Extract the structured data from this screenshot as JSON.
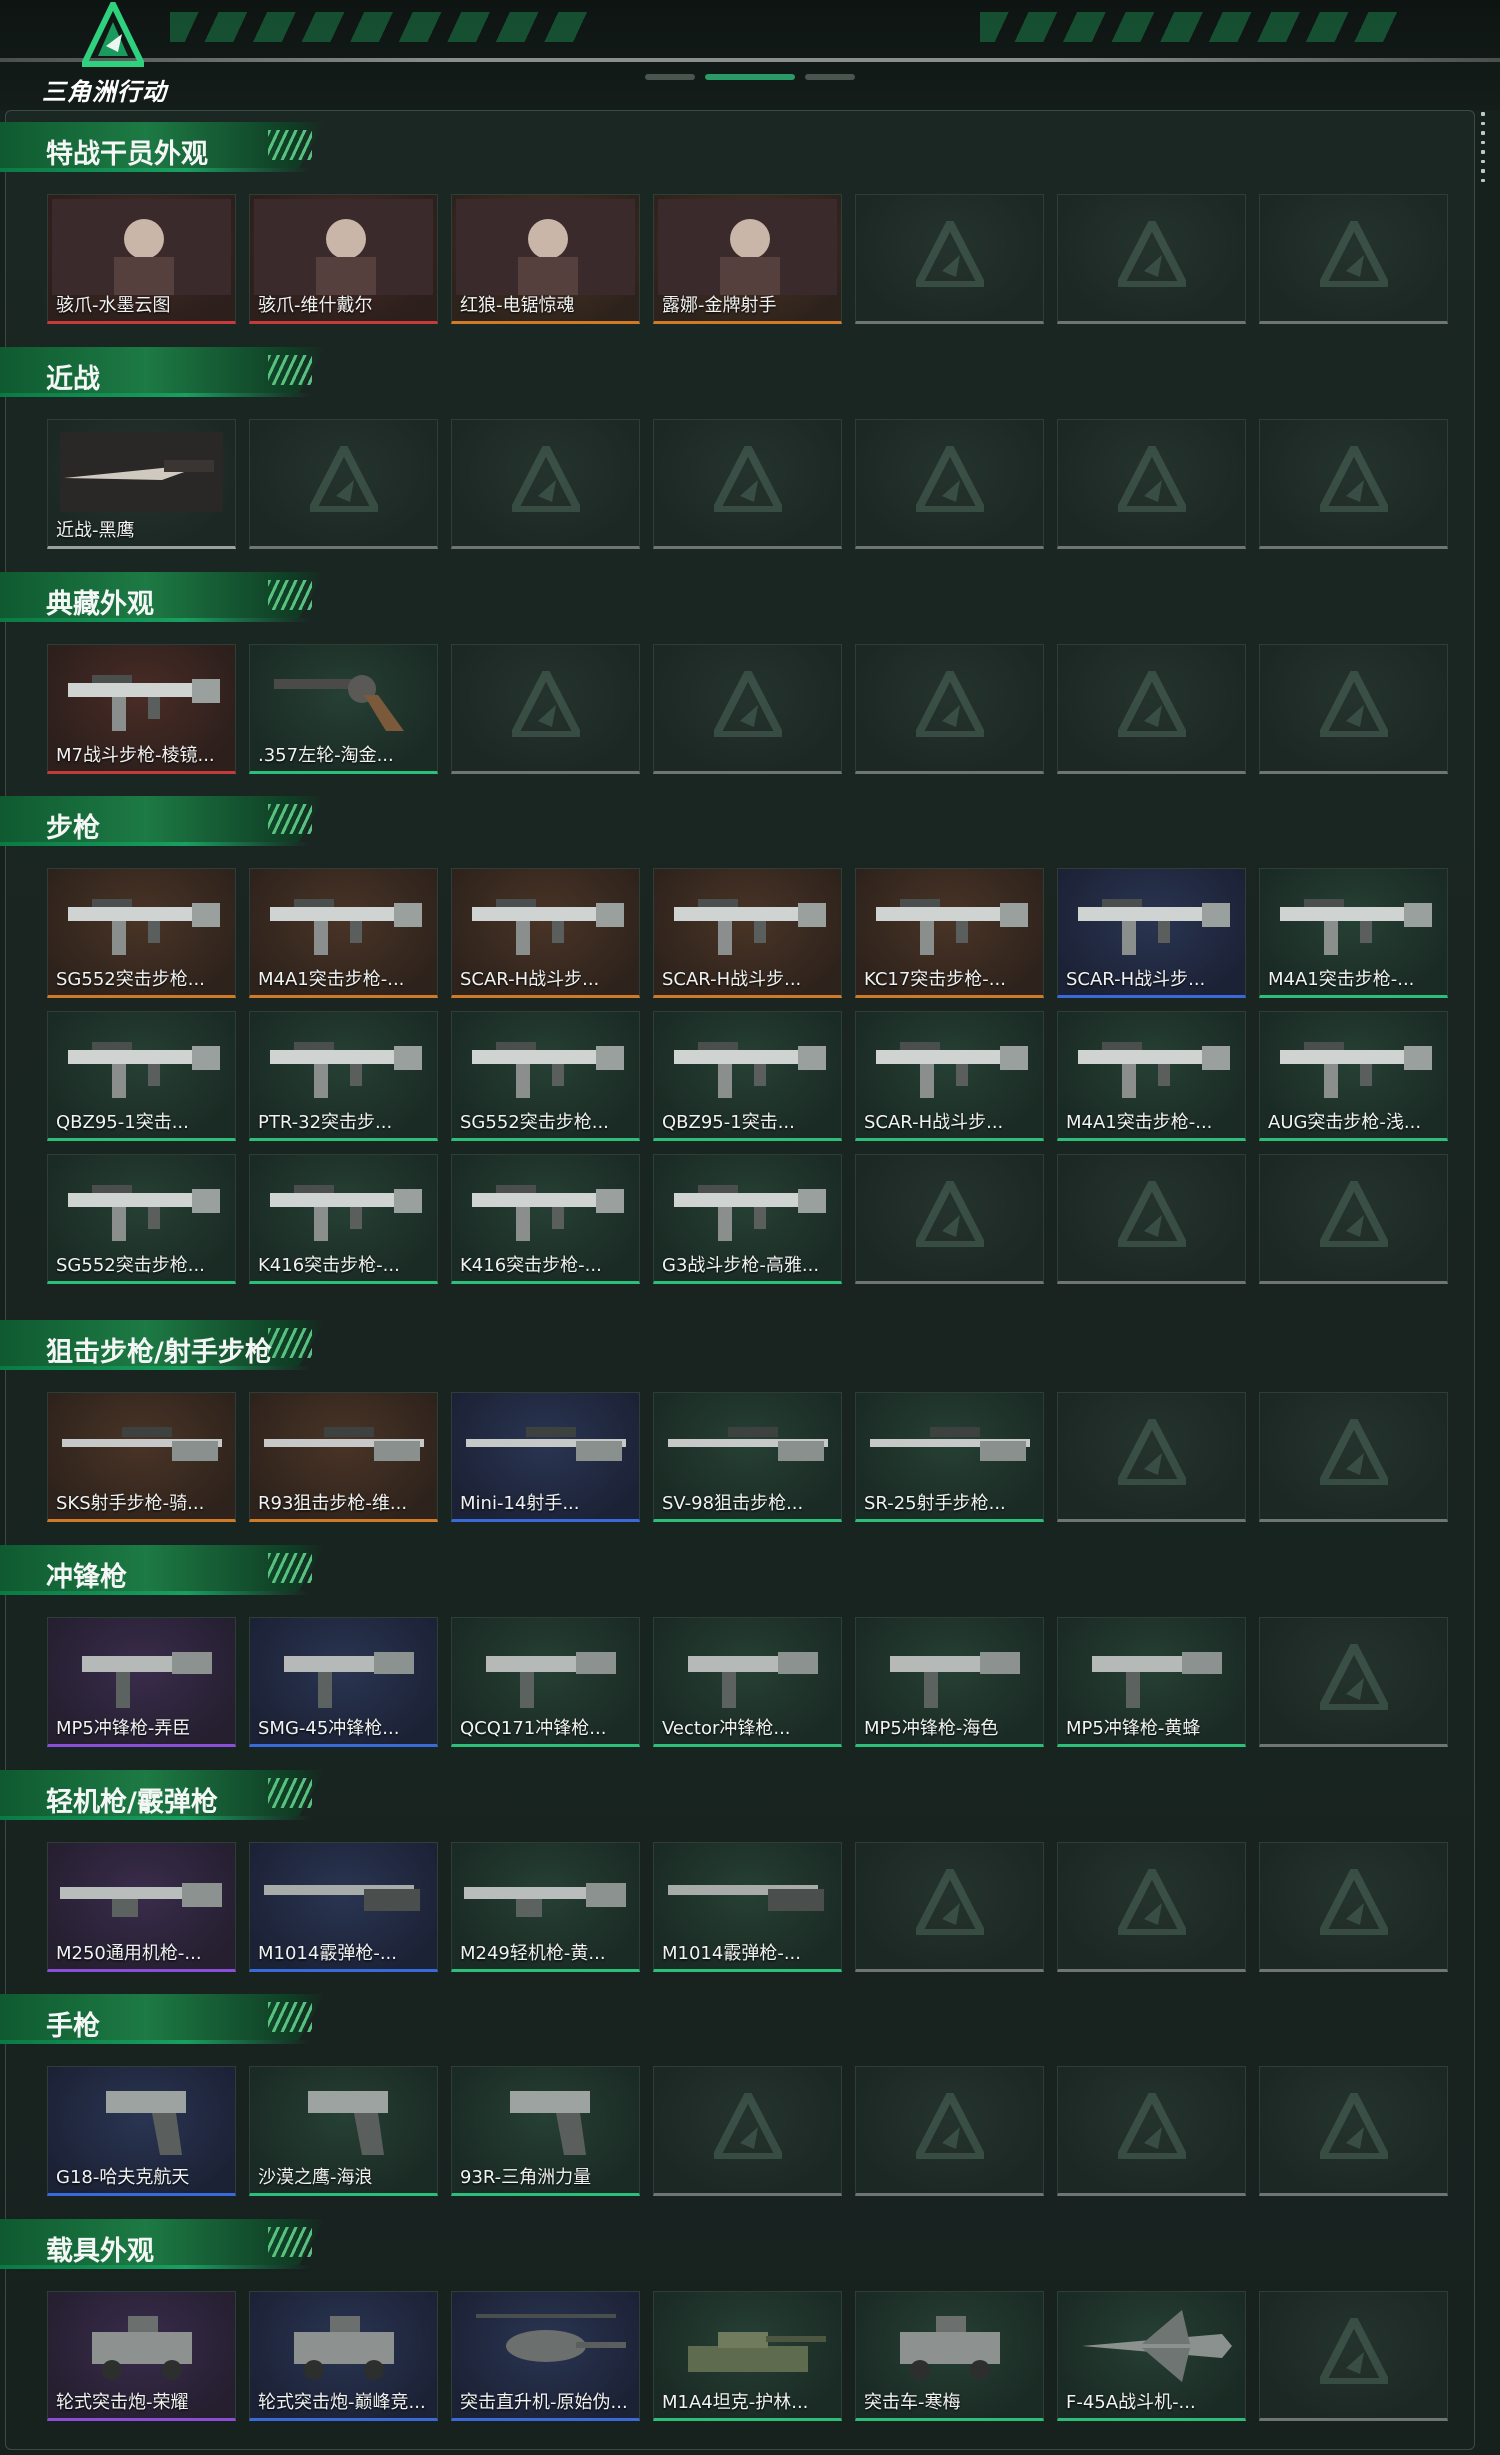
{
  "app": {
    "logo_text": "三角洲行动"
  },
  "colors": {
    "accent_green": "#1d7a44",
    "quality_red": "#c53a3a",
    "quality_orange": "#cf7a28",
    "quality_purple": "#8a4fd6",
    "quality_blue": "#3a6ad8",
    "quality_green": "#2dbf7a"
  },
  "sections": [
    {
      "title": "特战干员外观",
      "items": [
        {
          "label": "骇爪-水墨云图",
          "quality": "red",
          "icon": "operator-portrait-icon"
        },
        {
          "label": "骇爪-维什戴尔",
          "quality": "red",
          "icon": "operator-portrait-icon"
        },
        {
          "label": "红狼-电锯惊魂",
          "quality": "orange",
          "icon": "operator-portrait-icon"
        },
        {
          "label": "露娜-金牌射手",
          "quality": "orange",
          "icon": "operator-portrait-icon"
        },
        null,
        null,
        null
      ]
    },
    {
      "title": "近战",
      "items": [
        {
          "label": "近战-黑鹰",
          "quality": "gray",
          "icon": "knife-icon"
        },
        null,
        null,
        null,
        null,
        null,
        null
      ]
    },
    {
      "title": "典藏外观",
      "items": [
        {
          "label": "M7战斗步枪-棱镜...",
          "quality": "red",
          "icon": "rifle-icon"
        },
        {
          "label": ".357左轮-淘金...",
          "quality": "green",
          "icon": "revolver-icon"
        },
        null,
        null,
        null,
        null,
        null
      ]
    },
    {
      "title": "步枪",
      "items": [
        {
          "label": "SG552突击步枪...",
          "quality": "orange",
          "icon": "rifle-icon"
        },
        {
          "label": "M4A1突击步枪-...",
          "quality": "orange",
          "icon": "rifle-icon"
        },
        {
          "label": "SCAR-H战斗步...",
          "quality": "orange",
          "icon": "rifle-icon"
        },
        {
          "label": "SCAR-H战斗步...",
          "quality": "orange",
          "icon": "rifle-icon"
        },
        {
          "label": "KC17突击步枪-...",
          "quality": "orange",
          "icon": "rifle-icon"
        },
        {
          "label": "SCAR-H战斗步...",
          "quality": "blue",
          "icon": "rifle-icon"
        },
        {
          "label": "M4A1突击步枪-...",
          "quality": "green",
          "icon": "rifle-icon"
        },
        {
          "label": "QBZ95-1突击...",
          "quality": "green",
          "icon": "rifle-icon"
        },
        {
          "label": "PTR-32突击步...",
          "quality": "green",
          "icon": "rifle-icon"
        },
        {
          "label": "SG552突击步枪...",
          "quality": "green",
          "icon": "rifle-icon"
        },
        {
          "label": "QBZ95-1突击...",
          "quality": "green",
          "icon": "rifle-icon"
        },
        {
          "label": "SCAR-H战斗步...",
          "quality": "green",
          "icon": "rifle-icon"
        },
        {
          "label": "M4A1突击步枪-...",
          "quality": "green",
          "icon": "rifle-icon"
        },
        {
          "label": "AUG突击步枪-浅...",
          "quality": "green",
          "icon": "rifle-icon"
        },
        {
          "label": "SG552突击步枪...",
          "quality": "green",
          "icon": "rifle-icon"
        },
        {
          "label": "K416突击步枪-...",
          "quality": "green",
          "icon": "rifle-icon"
        },
        {
          "label": "K416突击步枪-...",
          "quality": "green",
          "icon": "rifle-icon"
        },
        {
          "label": "G3战斗步枪-高雅...",
          "quality": "green",
          "icon": "rifle-icon"
        },
        null,
        null,
        null
      ]
    },
    {
      "title": "狙击步枪/射手步枪",
      "items": [
        {
          "label": "SKS射手步枪-骑...",
          "quality": "orange",
          "icon": "sniper-icon"
        },
        {
          "label": "R93狙击步枪-维...",
          "quality": "orange",
          "icon": "sniper-icon"
        },
        {
          "label": "Mini-14射手...",
          "quality": "blue",
          "icon": "sniper-icon"
        },
        {
          "label": "SV-98狙击步枪...",
          "quality": "green",
          "icon": "sniper-icon"
        },
        {
          "label": "SR-25射手步枪...",
          "quality": "green",
          "icon": "sniper-icon"
        },
        null,
        null
      ]
    },
    {
      "title": "冲锋枪",
      "items": [
        {
          "label": "MP5冲锋枪-弄臣",
          "quality": "purple",
          "icon": "smg-icon"
        },
        {
          "label": "SMG-45冲锋枪...",
          "quality": "blue",
          "icon": "smg-icon"
        },
        {
          "label": "QCQ171冲锋枪...",
          "quality": "green",
          "icon": "smg-icon"
        },
        {
          "label": "Vector冲锋枪...",
          "quality": "green",
          "icon": "smg-icon"
        },
        {
          "label": "MP5冲锋枪-海色",
          "quality": "green",
          "icon": "smg-icon"
        },
        {
          "label": "MP5冲锋枪-黄蜂",
          "quality": "green",
          "icon": "smg-icon"
        },
        null
      ]
    },
    {
      "title": "轻机枪/霰弹枪",
      "items": [
        {
          "label": "M250通用机枪-...",
          "quality": "purple",
          "icon": "lmg-icon"
        },
        {
          "label": "M1014霰弹枪-...",
          "quality": "blue",
          "icon": "shotgun-icon"
        },
        {
          "label": "M249轻机枪-黄...",
          "quality": "green",
          "icon": "lmg-icon"
        },
        {
          "label": "M1014霰弹枪-...",
          "quality": "green",
          "icon": "shotgun-icon"
        },
        null,
        null,
        null
      ]
    },
    {
      "title": "手枪",
      "items": [
        {
          "label": "G18-哈夫克航天",
          "quality": "blue",
          "icon": "pistol-icon"
        },
        {
          "label": "沙漠之鹰-海浪",
          "quality": "green",
          "icon": "pistol-icon"
        },
        {
          "label": "93R-三角洲力量",
          "quality": "green",
          "icon": "pistol-icon"
        },
        null,
        null,
        null,
        null
      ]
    },
    {
      "title": "载具外观",
      "items": [
        {
          "label": "轮式突击炮-荣耀",
          "quality": "purple",
          "icon": "vehicle-icon"
        },
        {
          "label": "轮式突击炮-巅峰竞...",
          "quality": "blue",
          "icon": "vehicle-icon"
        },
        {
          "label": "突击直升机-原始伪...",
          "quality": "blue",
          "icon": "helicopter-icon"
        },
        {
          "label": "M1A4坦克-护林...",
          "quality": "green",
          "icon": "tank-icon"
        },
        {
          "label": "突击车-寒梅",
          "quality": "green",
          "icon": "vehicle-icon"
        },
        {
          "label": "F-45A战斗机-...",
          "quality": "green",
          "icon": "jet-icon"
        },
        null
      ]
    }
  ]
}
